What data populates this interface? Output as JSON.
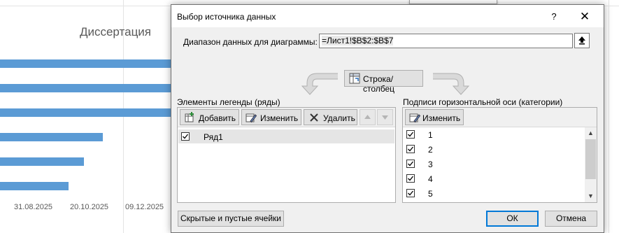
{
  "background_chart": {
    "title": "Диссертация",
    "bar_values_fraction": [
      1.0,
      1.0,
      1.0,
      0.6,
      0.49,
      0.4
    ],
    "x_ticks": [
      "31.08.2025",
      "20.10.2025",
      "09.12.2025"
    ],
    "bar_color": "#5b9bd5"
  },
  "dialog": {
    "title": "Выбор источника данных",
    "help_label": "?",
    "close_label": "✕",
    "range_label": "Диапазон данных для диаграммы:",
    "range_value": "=Лист1!$B$2:$B$7",
    "switch_button_label": "Строка/столбец",
    "legend_panel": {
      "title": "Элементы легенды (ряды)",
      "add_label": "Добавить",
      "edit_label": "Изменить",
      "remove_label": "Удалить",
      "series": [
        {
          "label": "Ряд1",
          "checked": true
        }
      ]
    },
    "axis_panel": {
      "title": "Подписи горизонтальной оси (категории)",
      "edit_label": "Изменить",
      "categories": [
        {
          "label": "1",
          "checked": true
        },
        {
          "label": "2",
          "checked": true
        },
        {
          "label": "3",
          "checked": true
        },
        {
          "label": "4",
          "checked": true
        },
        {
          "label": "5",
          "checked": true
        }
      ]
    },
    "hidden_cells_label": "Скрытые и пустые ячейки",
    "ok_label": "ОК",
    "cancel_label": "Отмена"
  }
}
